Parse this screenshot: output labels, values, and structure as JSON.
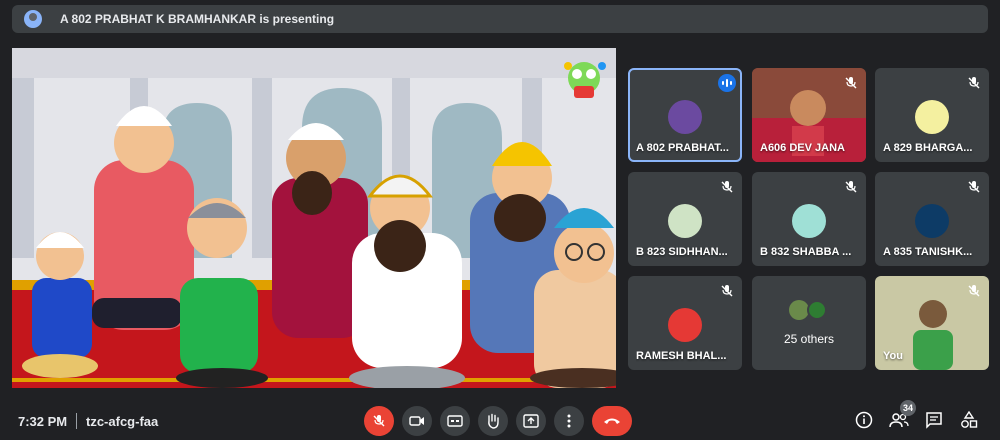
{
  "presenting": {
    "text": "A 802 PRABHAT K BRAMHANKAR is presenting"
  },
  "stage": {
    "description_icon": "cartoon-prayer-scene",
    "badge_icon": "channel-logo-icon"
  },
  "participants": [
    {
      "name": "A 802 PRABHAT...",
      "speaking": true,
      "avatar_color": "#6b4aa0"
    },
    {
      "name": "A606 DEV JANA",
      "muted": true,
      "video": true
    },
    {
      "name": "A 829 BHARGA...",
      "muted": true,
      "avatar_color": "#f4f0a0"
    },
    {
      "name": "B 823 SIDHHAN...",
      "muted": true,
      "avatar_color": "#cfe3c5"
    },
    {
      "name": "B 832 SHABBA ...",
      "muted": true,
      "avatar_color": "#9fe0d6"
    },
    {
      "name": "A 835 TANISHK...",
      "muted": true,
      "avatar_color": "#0d3b66"
    },
    {
      "name": "RAMESH BHAL...",
      "muted": true,
      "avatar_color": "#e53935"
    },
    {
      "name": "25 others",
      "others": true
    },
    {
      "name": "You",
      "muted": true,
      "video": true
    }
  ],
  "bottom": {
    "time": "7:32 PM",
    "meeting_code": "tzc-afcg-faa",
    "people_count": "34"
  },
  "colors": {
    "background": "#202124",
    "tile": "#3c4043",
    "accent": "#8ab4f8",
    "danger": "#ea4335"
  }
}
